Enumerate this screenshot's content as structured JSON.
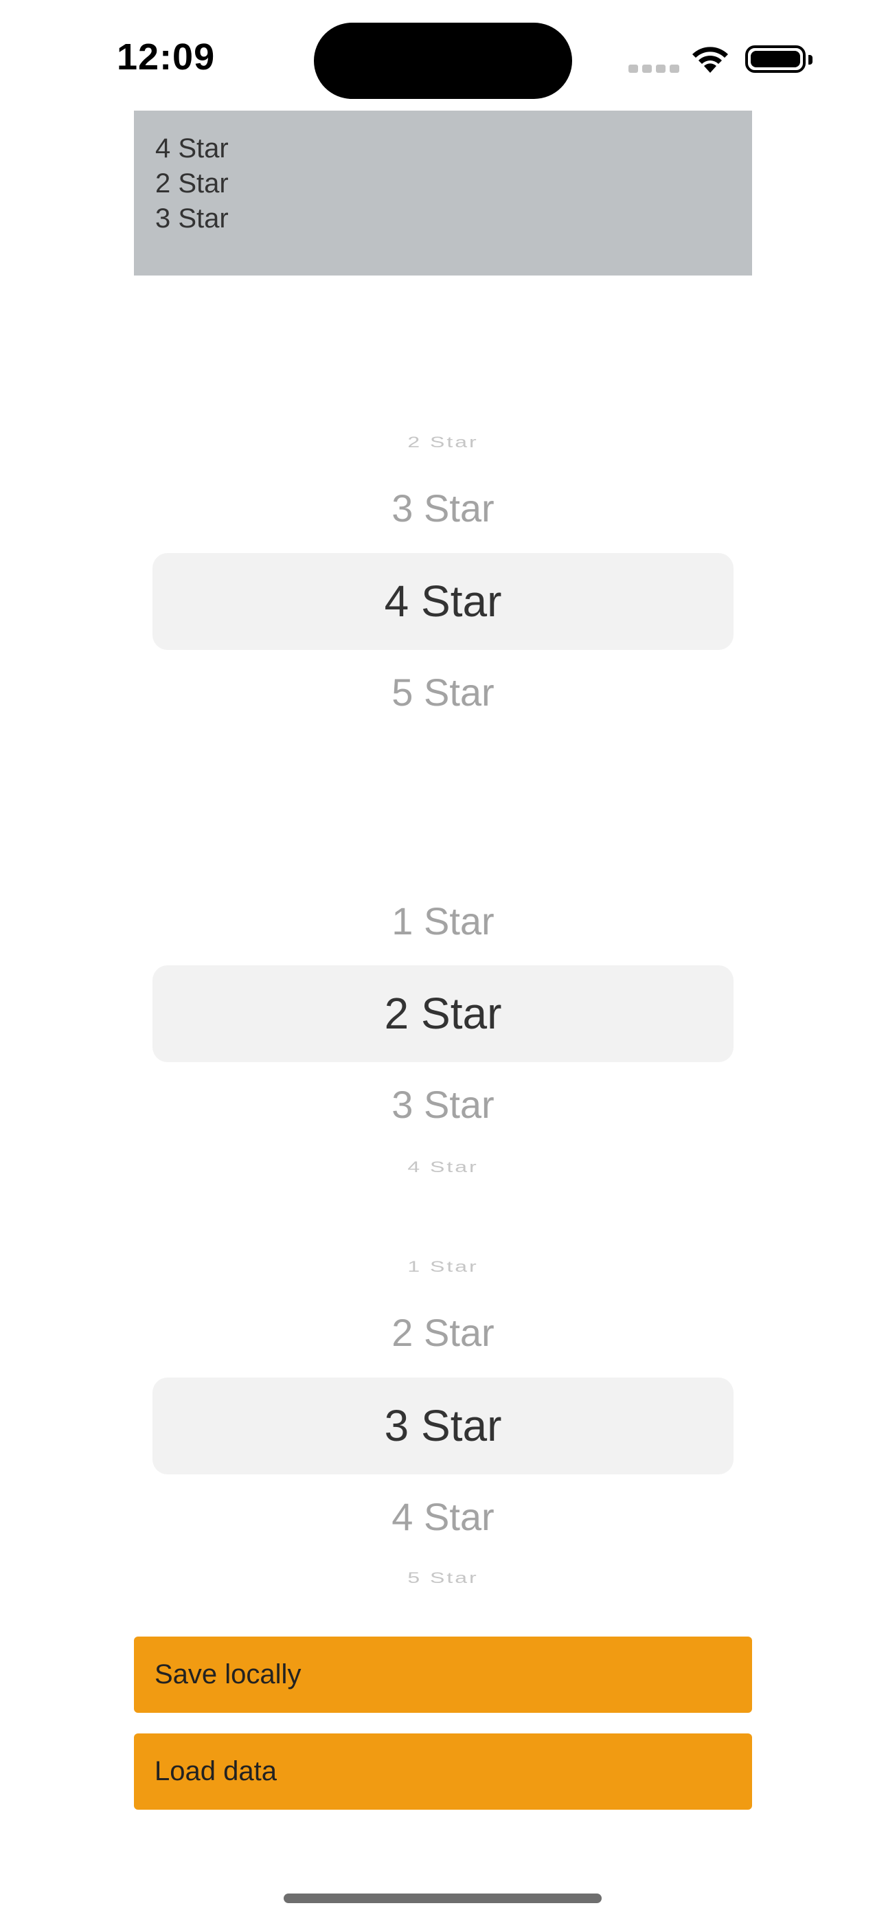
{
  "status_bar": {
    "time": "12:09"
  },
  "summary": {
    "lines": [
      "4 Star",
      "2 Star",
      "3 Star"
    ]
  },
  "pickers": [
    {
      "rows": [
        "2 Star",
        "3 Star",
        "4 Star",
        "5 Star"
      ],
      "selected": "4 Star"
    },
    {
      "rows": [
        "1 Star",
        "2 Star",
        "3 Star",
        "4 Star"
      ],
      "selected": "2 Star"
    },
    {
      "rows": [
        "1 Star",
        "2 Star",
        "3 Star",
        "4 Star",
        "5 Star"
      ],
      "selected": "3 Star"
    }
  ],
  "buttons": {
    "save_label": "Save locally",
    "load_label": "Load data"
  },
  "colors": {
    "accent": "#f19b12",
    "summary_bg": "#bdc1c4",
    "picker_selection_bg": "#f2f2f2"
  }
}
